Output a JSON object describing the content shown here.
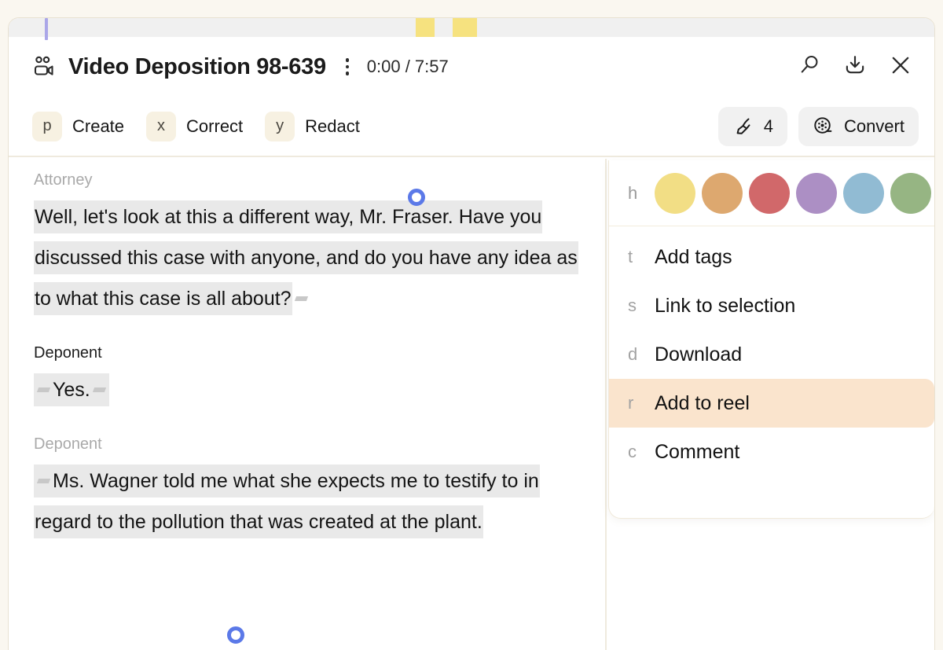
{
  "theme": {
    "page_bg": "#faf7f0",
    "card_bg": "#ffffff",
    "border": "#e8e2d2",
    "accent_selected": "#fae4cd",
    "handle_blue": "#5b79e8",
    "timeline_marker": "#f6e27f",
    "playhead": "#aaa6e8",
    "selection_gray": "#e9e9e9"
  },
  "timeline": {
    "playhead_label": "playhead",
    "markers": [
      {
        "left_pct": 43.9,
        "width_pct": 2.0
      },
      {
        "left_pct": 47.9,
        "width_pct": 2.6
      }
    ]
  },
  "header": {
    "icon": "video-people-icon",
    "title": "Video Deposition 98-639",
    "menu_icon": "kebab-menu-icon",
    "timecode": "0:00 / 7:57",
    "actions": [
      {
        "icon": "search-icon",
        "name": "search-button"
      },
      {
        "icon": "download-icon",
        "name": "download-button"
      },
      {
        "icon": "close-icon",
        "name": "close-button"
      }
    ]
  },
  "toolbar": {
    "shortcuts": [
      {
        "key": "p",
        "label": "Create"
      },
      {
        "key": "x",
        "label": "Correct"
      },
      {
        "key": "y",
        "label": "Redact"
      }
    ],
    "highlight_count": "4",
    "highlight_icon": "highlighter-pen-icon",
    "convert_label": "Convert",
    "convert_icon": "film-reel-icon"
  },
  "transcript": {
    "blocks": [
      {
        "speaker": "Attorney",
        "speaker_state": "muted",
        "text": "Well, let's look at this a different way, Mr. Fraser. Have you discussed this case with anyone, and do you have any idea as to what this case is all about?"
      },
      {
        "speaker": "Deponent",
        "speaker_state": "active",
        "text": "Yes."
      },
      {
        "speaker": "Deponent",
        "speaker_state": "muted",
        "text": "Ms. Wagner told me what she expects me to testify to in regard to the pollution that was created at the plant."
      }
    ]
  },
  "panel": {
    "colors_key": "h",
    "colors": [
      {
        "name": "yellow",
        "hex": "#f2de85"
      },
      {
        "name": "orange",
        "hex": "#dda86f"
      },
      {
        "name": "red",
        "hex": "#d1686a"
      },
      {
        "name": "purple",
        "hex": "#ac8fc4"
      },
      {
        "name": "blue",
        "hex": "#91bbd3"
      },
      {
        "name": "green",
        "hex": "#96b583"
      }
    ],
    "menu": [
      {
        "key": "t",
        "label": "Add tags",
        "selected": false
      },
      {
        "key": "s",
        "label": "Link to selection",
        "selected": false
      },
      {
        "key": "d",
        "label": "Download",
        "selected": false
      },
      {
        "key": "r",
        "label": "Add to reel",
        "selected": true
      },
      {
        "key": "c",
        "label": "Comment",
        "selected": false
      }
    ]
  }
}
